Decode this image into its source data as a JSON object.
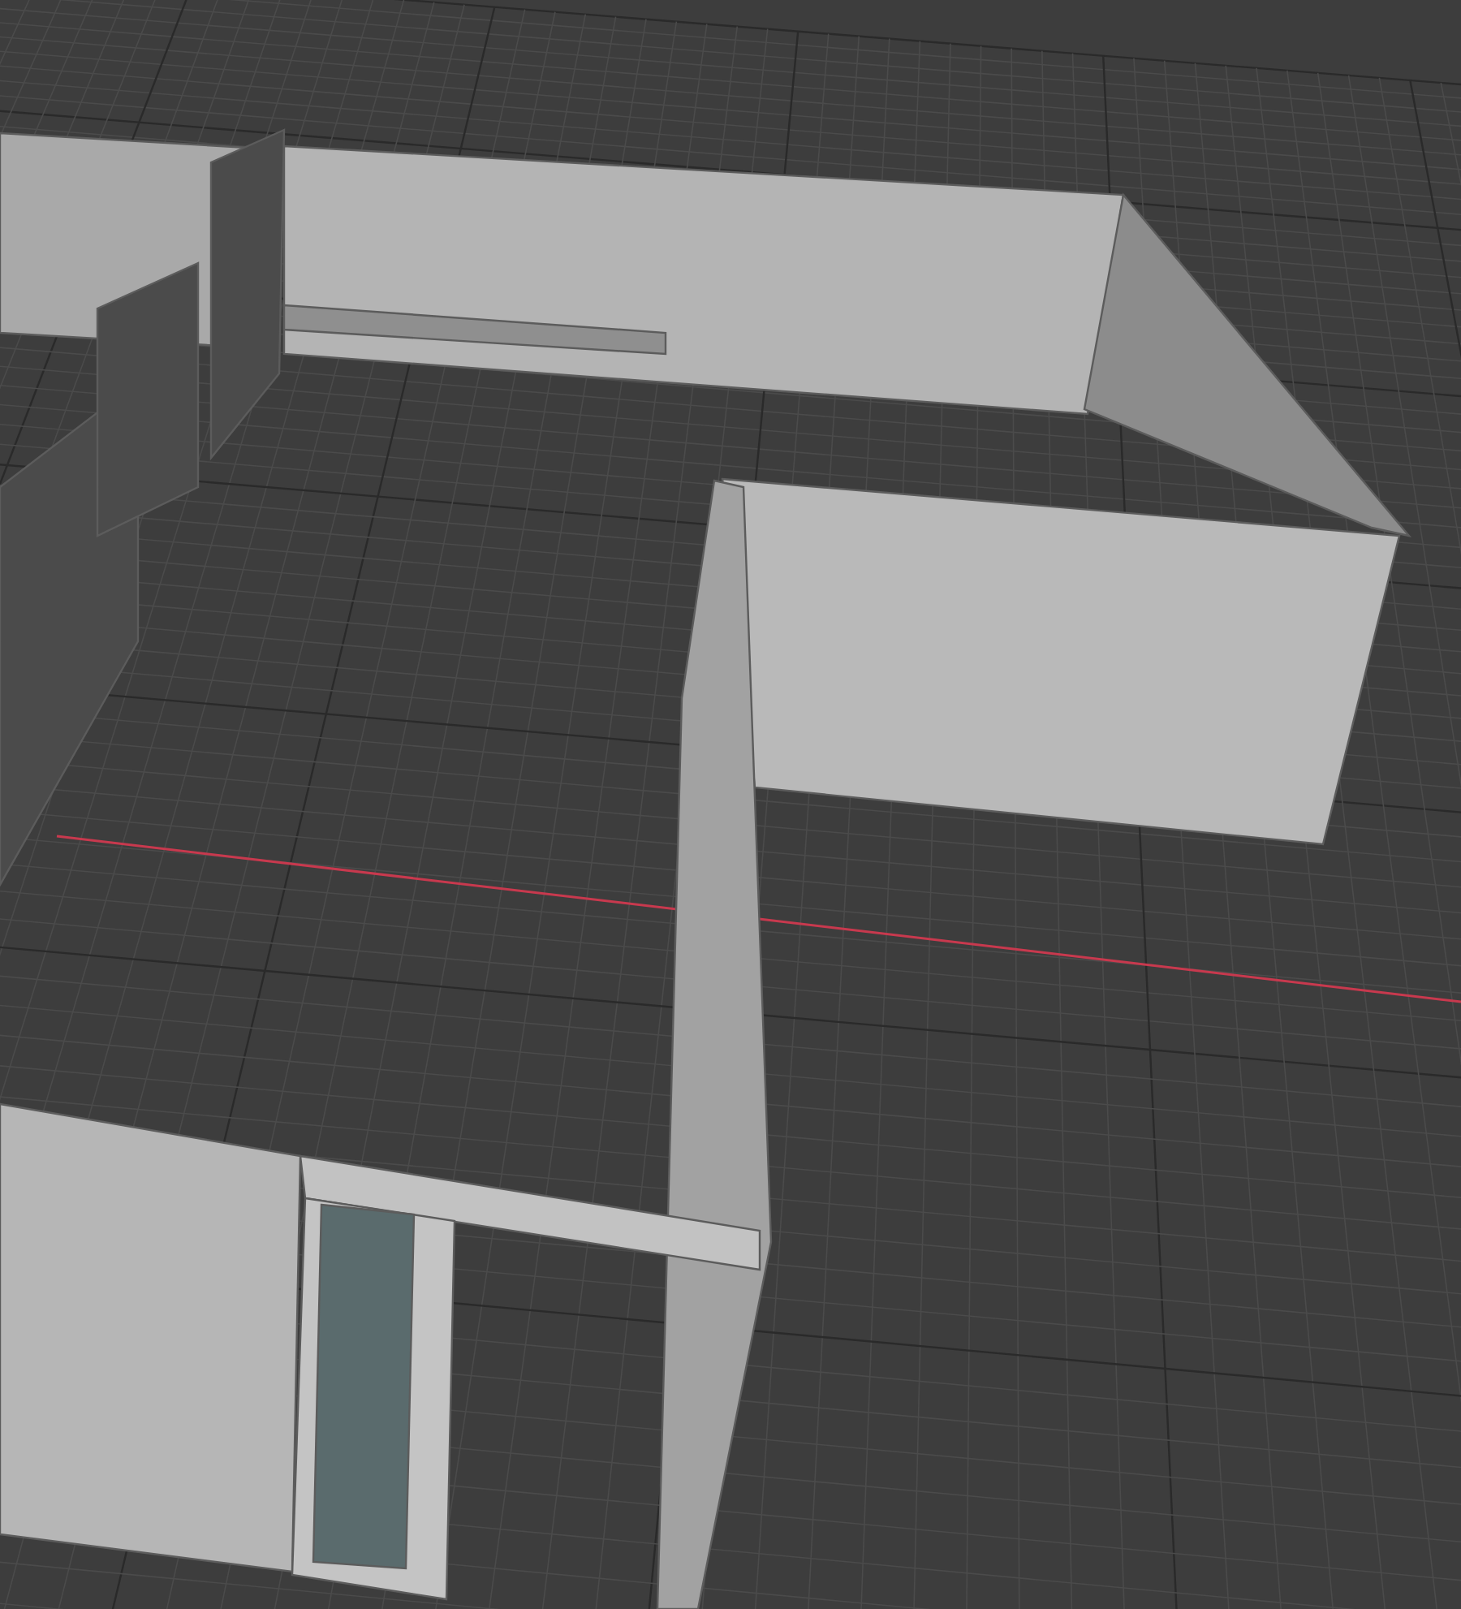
{
  "viewport": {
    "grid": true,
    "x_axis_line": true,
    "walls": true
  }
}
